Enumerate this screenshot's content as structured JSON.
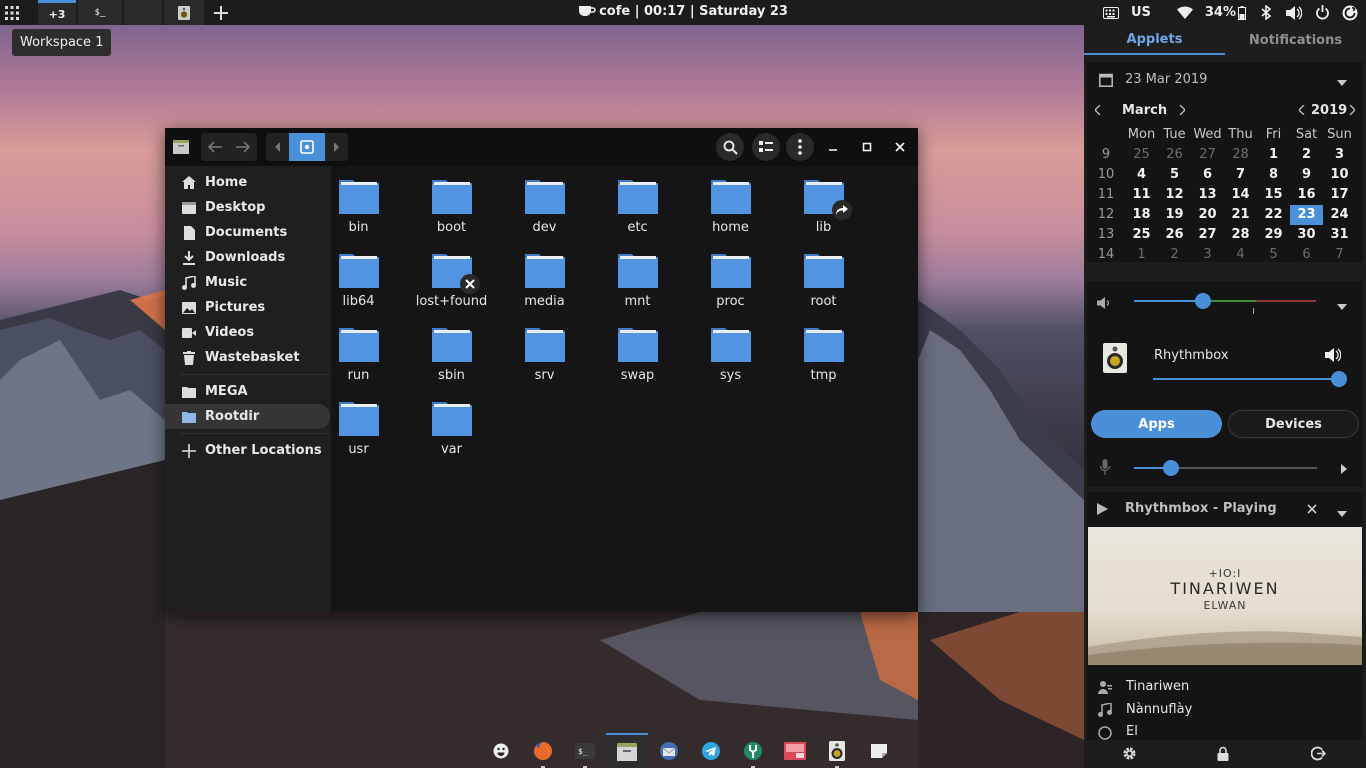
{
  "top_panel": {
    "workspace_badge": "+3",
    "terminal_thumb": "$_",
    "clock": "cofe | 00:17 | Saturday 23",
    "keyboard_layout": "US",
    "battery": "34%",
    "workspace_tooltip": "Workspace 1"
  },
  "file_manager": {
    "sidebar": {
      "places": [
        {
          "label": "Home",
          "icon": "home-icon"
        },
        {
          "label": "Desktop",
          "icon": "desktop-icon"
        },
        {
          "label": "Documents",
          "icon": "document-icon"
        },
        {
          "label": "Downloads",
          "icon": "download-icon"
        },
        {
          "label": "Music",
          "icon": "music-icon"
        },
        {
          "label": "Pictures",
          "icon": "picture-icon"
        },
        {
          "label": "Videos",
          "icon": "video-icon"
        },
        {
          "label": "Wastebasket",
          "icon": "trash-icon"
        }
      ],
      "bookmarks": [
        {
          "label": "MEGA",
          "icon": "folder-icon"
        },
        {
          "label": "Rootdir",
          "icon": "folder-icon"
        }
      ],
      "other_locations": "Other Locations"
    },
    "folders": [
      {
        "name": "bin",
        "emblem": ""
      },
      {
        "name": "boot",
        "emblem": ""
      },
      {
        "name": "dev",
        "emblem": ""
      },
      {
        "name": "etc",
        "emblem": ""
      },
      {
        "name": "home",
        "emblem": ""
      },
      {
        "name": "lib",
        "emblem": "symlink"
      },
      {
        "name": "lib64",
        "emblem": ""
      },
      {
        "name": "lost+found",
        "emblem": "unreadable"
      },
      {
        "name": "media",
        "emblem": ""
      },
      {
        "name": "mnt",
        "emblem": ""
      },
      {
        "name": "proc",
        "emblem": ""
      },
      {
        "name": "root",
        "emblem": ""
      },
      {
        "name": "run",
        "emblem": ""
      },
      {
        "name": "sbin",
        "emblem": ""
      },
      {
        "name": "srv",
        "emblem": ""
      },
      {
        "name": "swap",
        "emblem": ""
      },
      {
        "name": "sys",
        "emblem": ""
      },
      {
        "name": "tmp",
        "emblem": ""
      },
      {
        "name": "usr",
        "emblem": ""
      },
      {
        "name": "var",
        "emblem": ""
      }
    ]
  },
  "side_panel": {
    "tabs": [
      "Applets",
      "Notifications"
    ],
    "calendar": {
      "date_header": "23 Mar 2019",
      "month": "March",
      "year": "2019",
      "weekdays": [
        "Mon",
        "Tue",
        "Wed",
        "Thu",
        "Fri",
        "Sat",
        "Sun"
      ],
      "weeks": [
        {
          "wk": "9",
          "days": [
            "25",
            "26",
            "27",
            "28",
            "1",
            "2",
            "3"
          ],
          "dim": [
            true,
            true,
            true,
            true,
            false,
            false,
            false
          ]
        },
        {
          "wk": "10",
          "days": [
            "4",
            "5",
            "6",
            "7",
            "8",
            "9",
            "10"
          ],
          "dim": [
            false,
            false,
            false,
            false,
            false,
            false,
            false
          ]
        },
        {
          "wk": "11",
          "days": [
            "11",
            "12",
            "13",
            "14",
            "15",
            "16",
            "17"
          ],
          "dim": [
            false,
            false,
            false,
            false,
            false,
            false,
            false
          ]
        },
        {
          "wk": "12",
          "days": [
            "18",
            "19",
            "20",
            "21",
            "22",
            "23",
            "24"
          ],
          "dim": [
            false,
            false,
            false,
            false,
            false,
            false,
            false
          ]
        },
        {
          "wk": "13",
          "days": [
            "25",
            "26",
            "27",
            "28",
            "29",
            "30",
            "31"
          ],
          "dim": [
            false,
            false,
            false,
            false,
            false,
            false,
            false
          ]
        },
        {
          "wk": "14",
          "days": [
            "1",
            "2",
            "3",
            "4",
            "5",
            "6",
            "7"
          ],
          "dim": [
            true,
            true,
            true,
            true,
            true,
            true,
            true
          ]
        }
      ],
      "today": "23"
    },
    "volume": {
      "master_level": 0.5,
      "app_name": "Rhythmbox",
      "app_level": 1.0,
      "buttons": [
        "Apps",
        "Devices"
      ],
      "mic_level": 0.2
    },
    "player": {
      "title": "Rhythmbox - Playing",
      "album_art_band": "TINARIWEN",
      "album_art_symbol": "+IO:I",
      "album_art_album": "ELWAN",
      "artist": "Tinariwen",
      "track": "Nànnuflày",
      "album_cutoff": "El"
    },
    "footer_icons": [
      "gear-icon",
      "lock-icon",
      "logout-icon"
    ]
  },
  "dock": {
    "items": [
      "emoji-icon",
      "firefox-icon",
      "terminal-icon",
      "files-icon",
      "thunderbird-icon",
      "telegram-icon",
      "toolbox-icon",
      "photos-icon",
      "rhythmbox-icon",
      "note-icon"
    ]
  },
  "colors": {
    "accent": "#4a90d9",
    "folder": "#5294e2",
    "panel_bg": "#1c1c1c"
  }
}
